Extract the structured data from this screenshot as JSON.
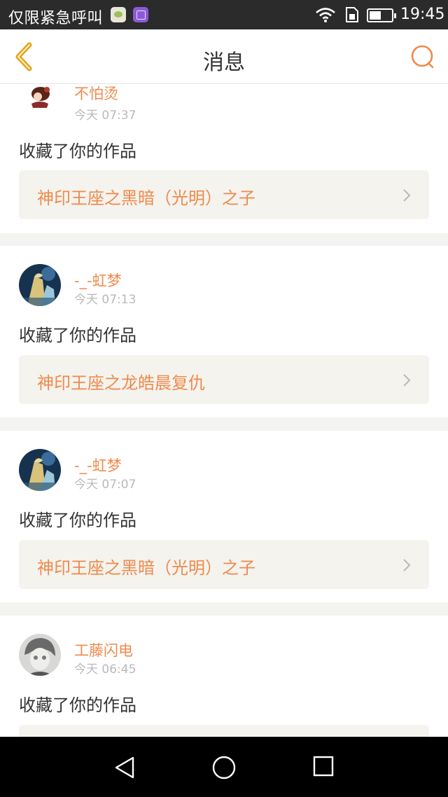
{
  "status_bar": {
    "carrier": "仅限紧急呼叫",
    "time": "19:45",
    "icons": [
      "wechat-icon",
      "gallery-icon",
      "wifi-icon",
      "sim-icon",
      "battery-icon"
    ]
  },
  "header": {
    "title": "消息",
    "back_icon": "chevron-left-icon",
    "search_icon": "search-icon",
    "accent_color": "#ef8a4c"
  },
  "messages": [
    {
      "user": "不怕烫",
      "time": "今天 07:37",
      "action": "收藏了你的作品",
      "work_title": "神印王座之黑暗（光明）之子"
    },
    {
      "user": "-_-虹梦",
      "time": "今天 07:13",
      "action": "收藏了你的作品",
      "work_title": "神印王座之龙皓晨复仇"
    },
    {
      "user": "-_-虹梦",
      "time": "今天 07:07",
      "action": "收藏了你的作品",
      "work_title": "神印王座之黑暗（光明）之子"
    },
    {
      "user": "工藤闪电",
      "time": "今天 06:45",
      "action": "收藏了你的作品",
      "work_title": ""
    }
  ],
  "nav_bar": {
    "icons": [
      "nav-back-icon",
      "nav-home-icon",
      "nav-recent-icon"
    ]
  }
}
